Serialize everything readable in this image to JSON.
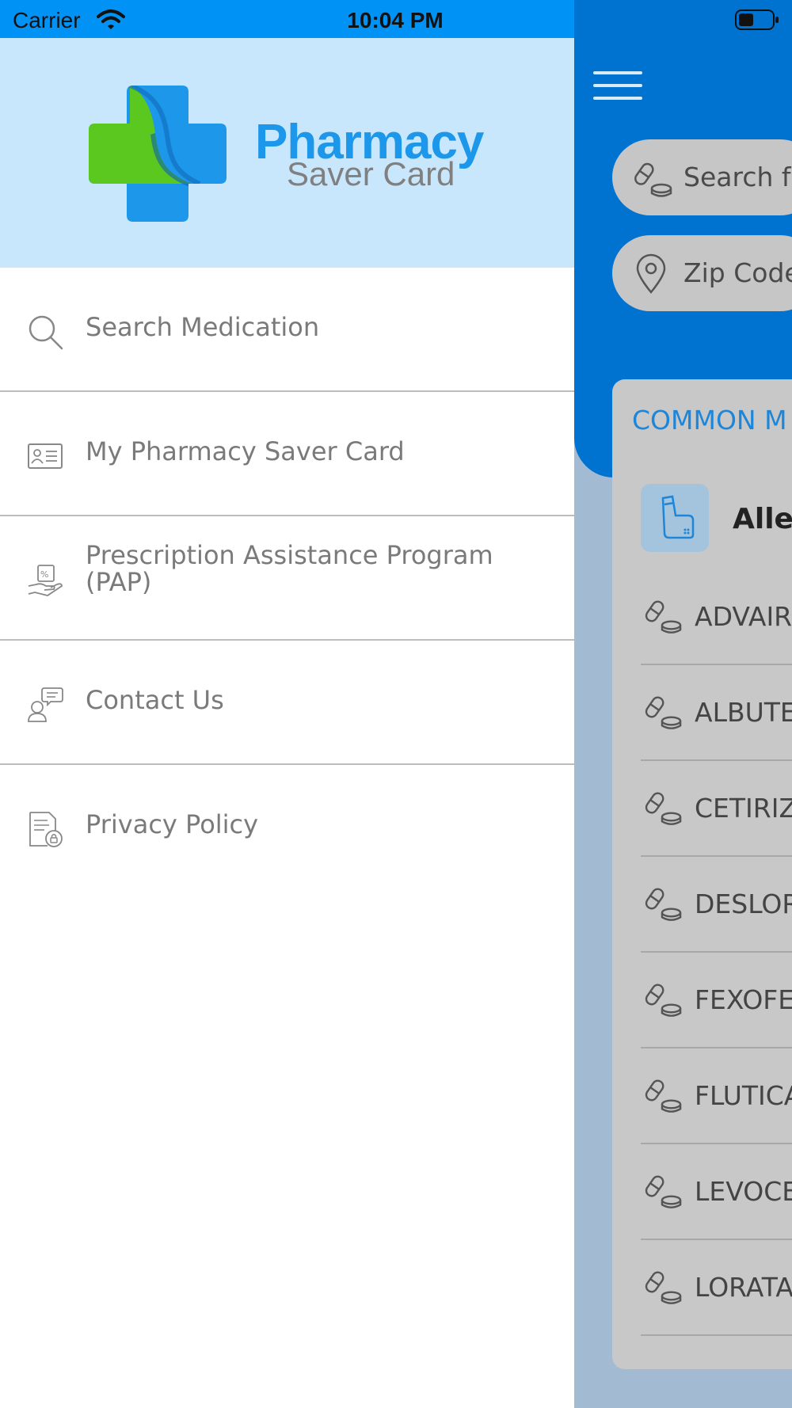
{
  "status_bar": {
    "carrier": "Carrier",
    "time": "10:04 PM"
  },
  "brand": {
    "title": "Pharmacy",
    "subtitle": "Saver Card"
  },
  "menu": {
    "items": [
      {
        "label": "Search Medication",
        "icon": "search-icon"
      },
      {
        "label": "My Pharmacy Saver Card",
        "icon": "id-card-icon"
      },
      {
        "label": "Prescription Assistance Program (PAP)",
        "icon": "hand-percent-icon"
      },
      {
        "label": "Contact Us",
        "icon": "support-chat-icon"
      },
      {
        "label": "Privacy Policy",
        "icon": "document-lock-icon"
      }
    ]
  },
  "background": {
    "search_placeholder": "Search fo",
    "zip_placeholder": "Zip Code",
    "section_title": "COMMON M",
    "category": "Aller",
    "medications": [
      "ADVAIR",
      "ALBUTE",
      "CETIRIZ",
      "DESLOR",
      "FEXOFE",
      "FLUTICA",
      "LEVOCE",
      "LORATA"
    ]
  },
  "colors": {
    "status_bar_left": "#0092f5",
    "app_header": "#0073d1",
    "drawer_header": "#c8e7fc",
    "brand_blue": "#1d97ea",
    "brand_green": "#5ac81f",
    "app_background": "#a3bbd2"
  }
}
